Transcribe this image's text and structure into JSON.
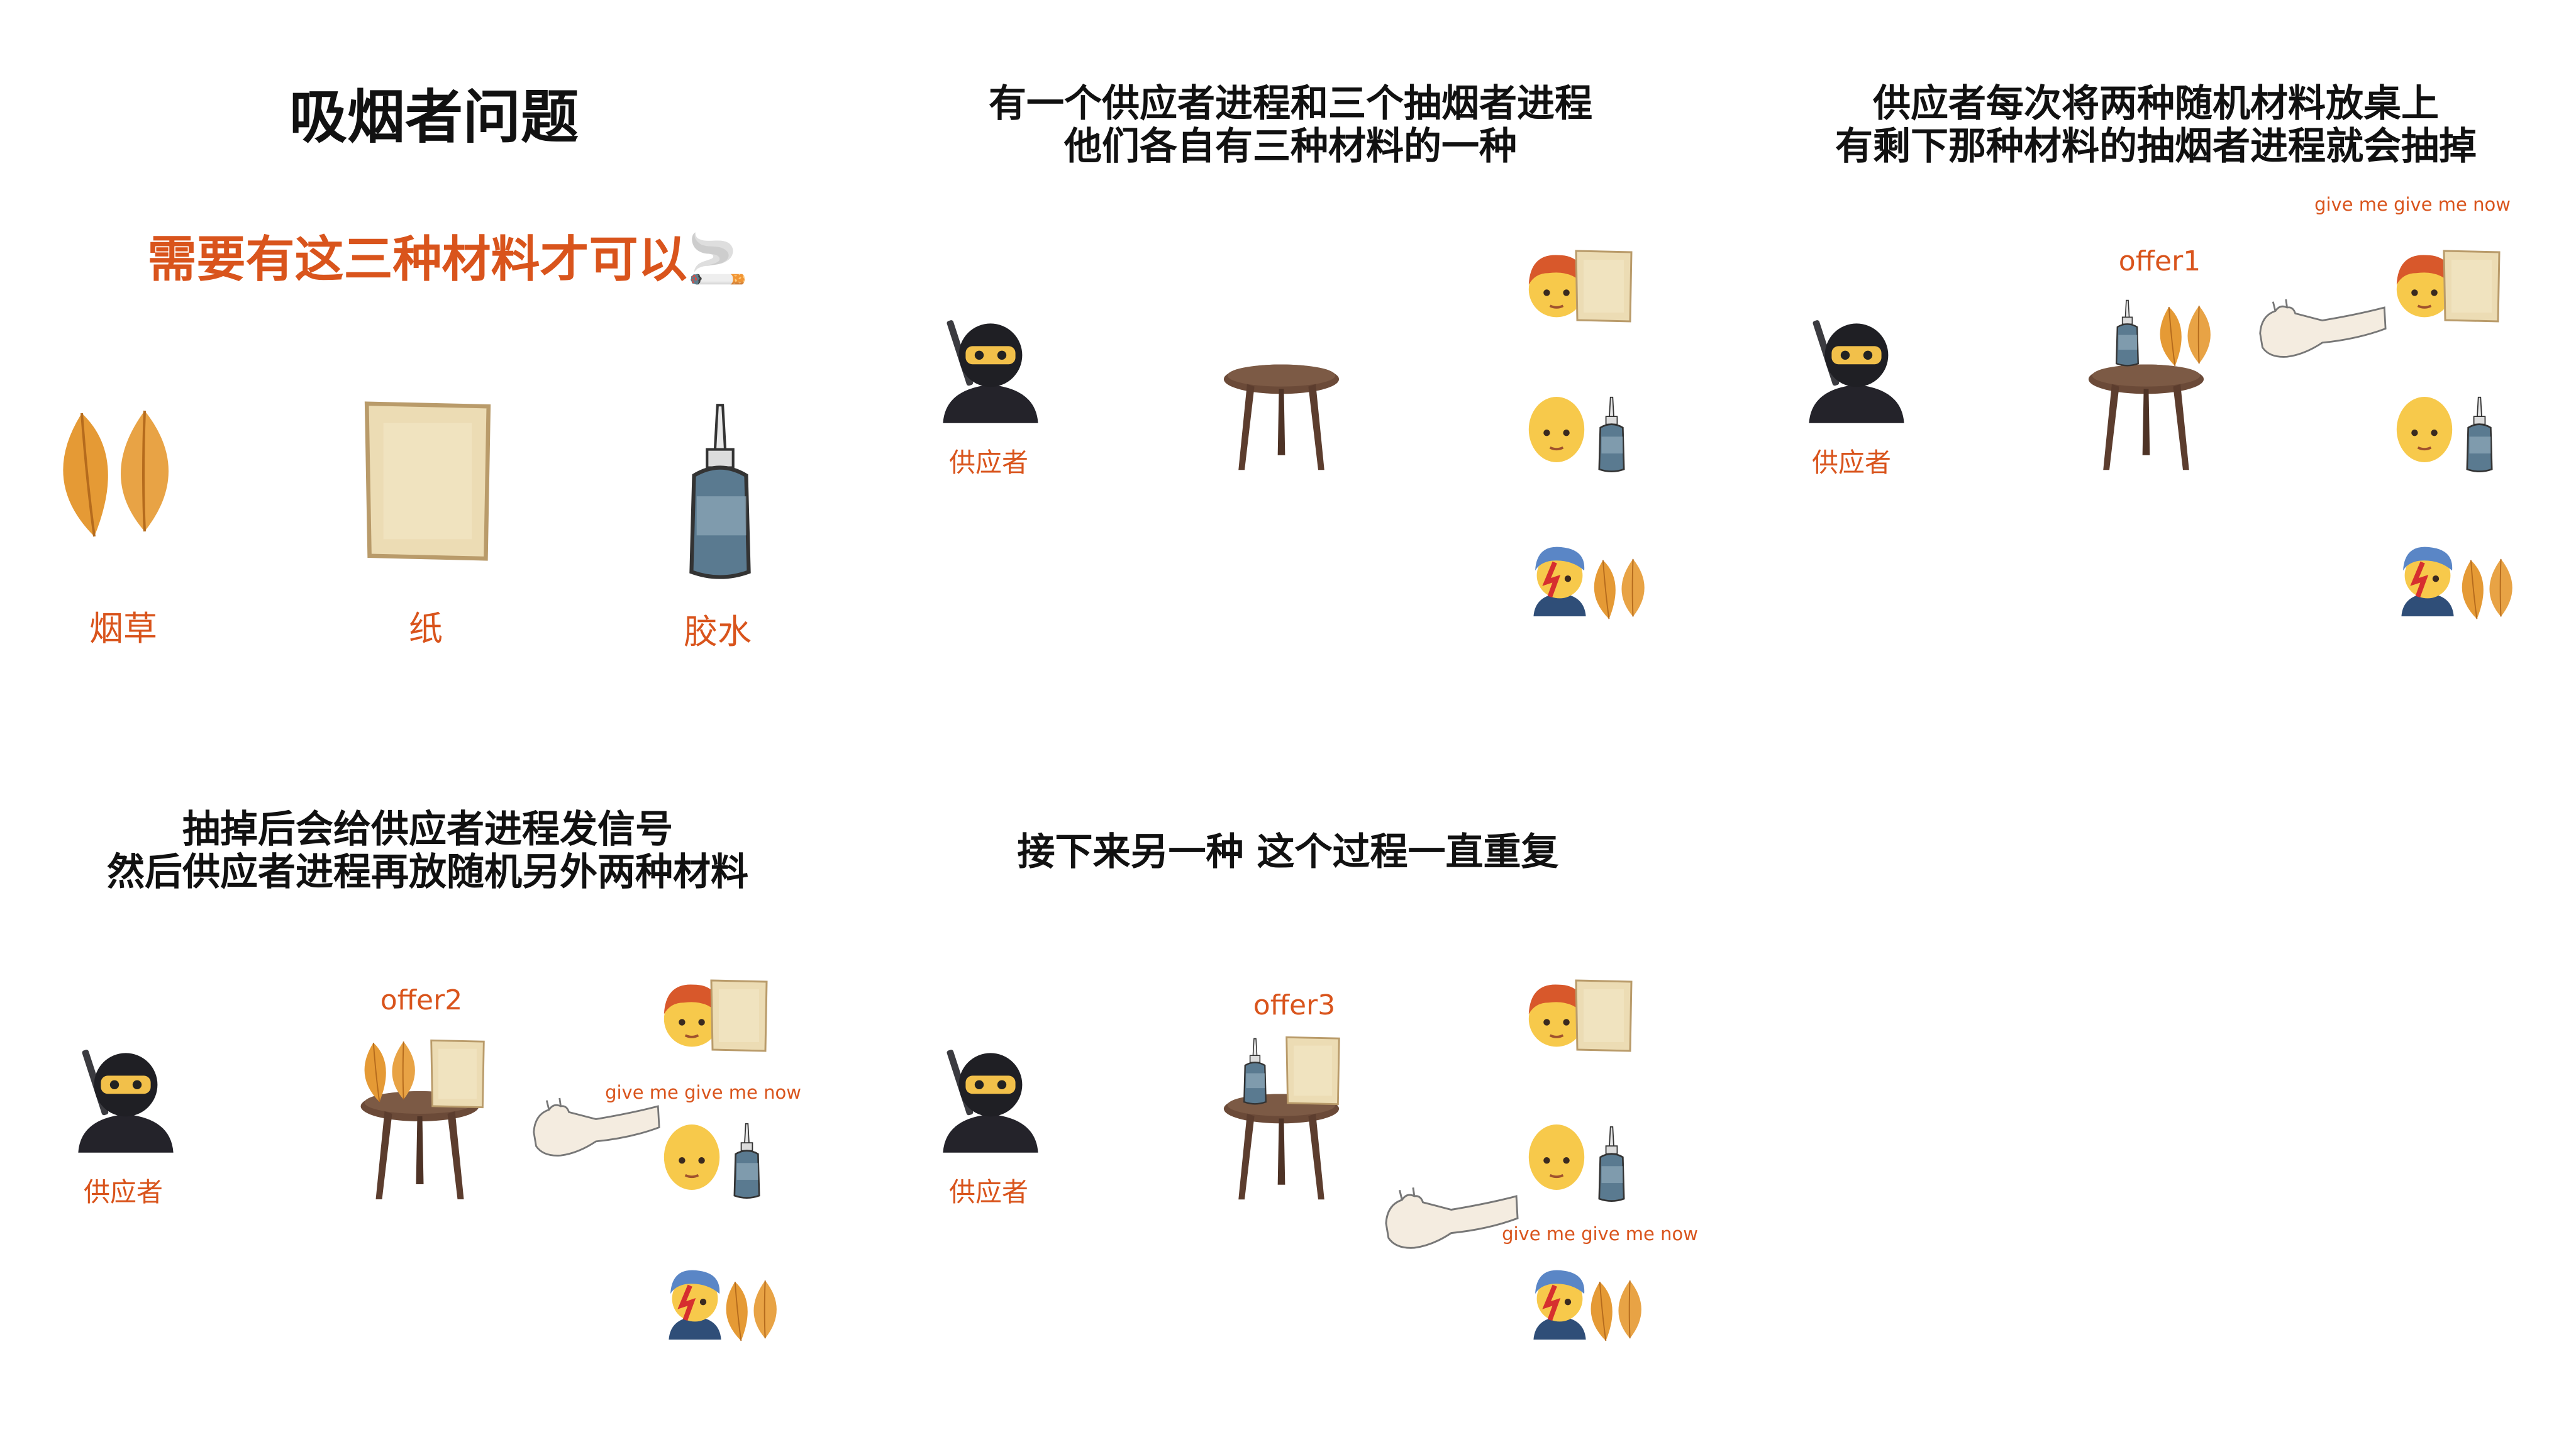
{
  "panel1": {
    "title": "吸烟者问题",
    "subtitle": "需要有这三种材料才可以🚬",
    "materials": [
      {
        "label": "烟草",
        "icon": "tobacco-leaves-icon"
      },
      {
        "label": "纸",
        "icon": "paper-icon"
      },
      {
        "label": "胶水",
        "icon": "glue-bottle-icon"
      }
    ]
  },
  "panel2": {
    "title_line1": "有一个供应者进程和三个抽烟者进程",
    "title_line2": "他们各自有三种材料的一种",
    "supplier_label": "供应者"
  },
  "panel3": {
    "title_line1": "供应者每次将两种随机材料放桌上",
    "title_line2": "有剩下那种材料的抽烟者进程就会抽掉",
    "offer": "offer1",
    "give_text": "give me give me now",
    "supplier_label": "供应者"
  },
  "panel4": {
    "title_line1": "抽掉后会给供应者进程发信号",
    "title_line2": "然后供应者进程再放随机另外两种材料",
    "offer": "offer2",
    "give_text": "give me give me now",
    "supplier_label": "供应者"
  },
  "panel5": {
    "title": "接下来另一种 这个过程一直重复",
    "offer": "offer3",
    "give_text": "give me give me now",
    "supplier_label": "供应者"
  },
  "colors": {
    "accent": "#d9541c",
    "title": "#111111",
    "table": "#6b4a38",
    "leaf": "#e59a35",
    "paper": "#ecdcb4",
    "glue": "#4a6a80"
  }
}
